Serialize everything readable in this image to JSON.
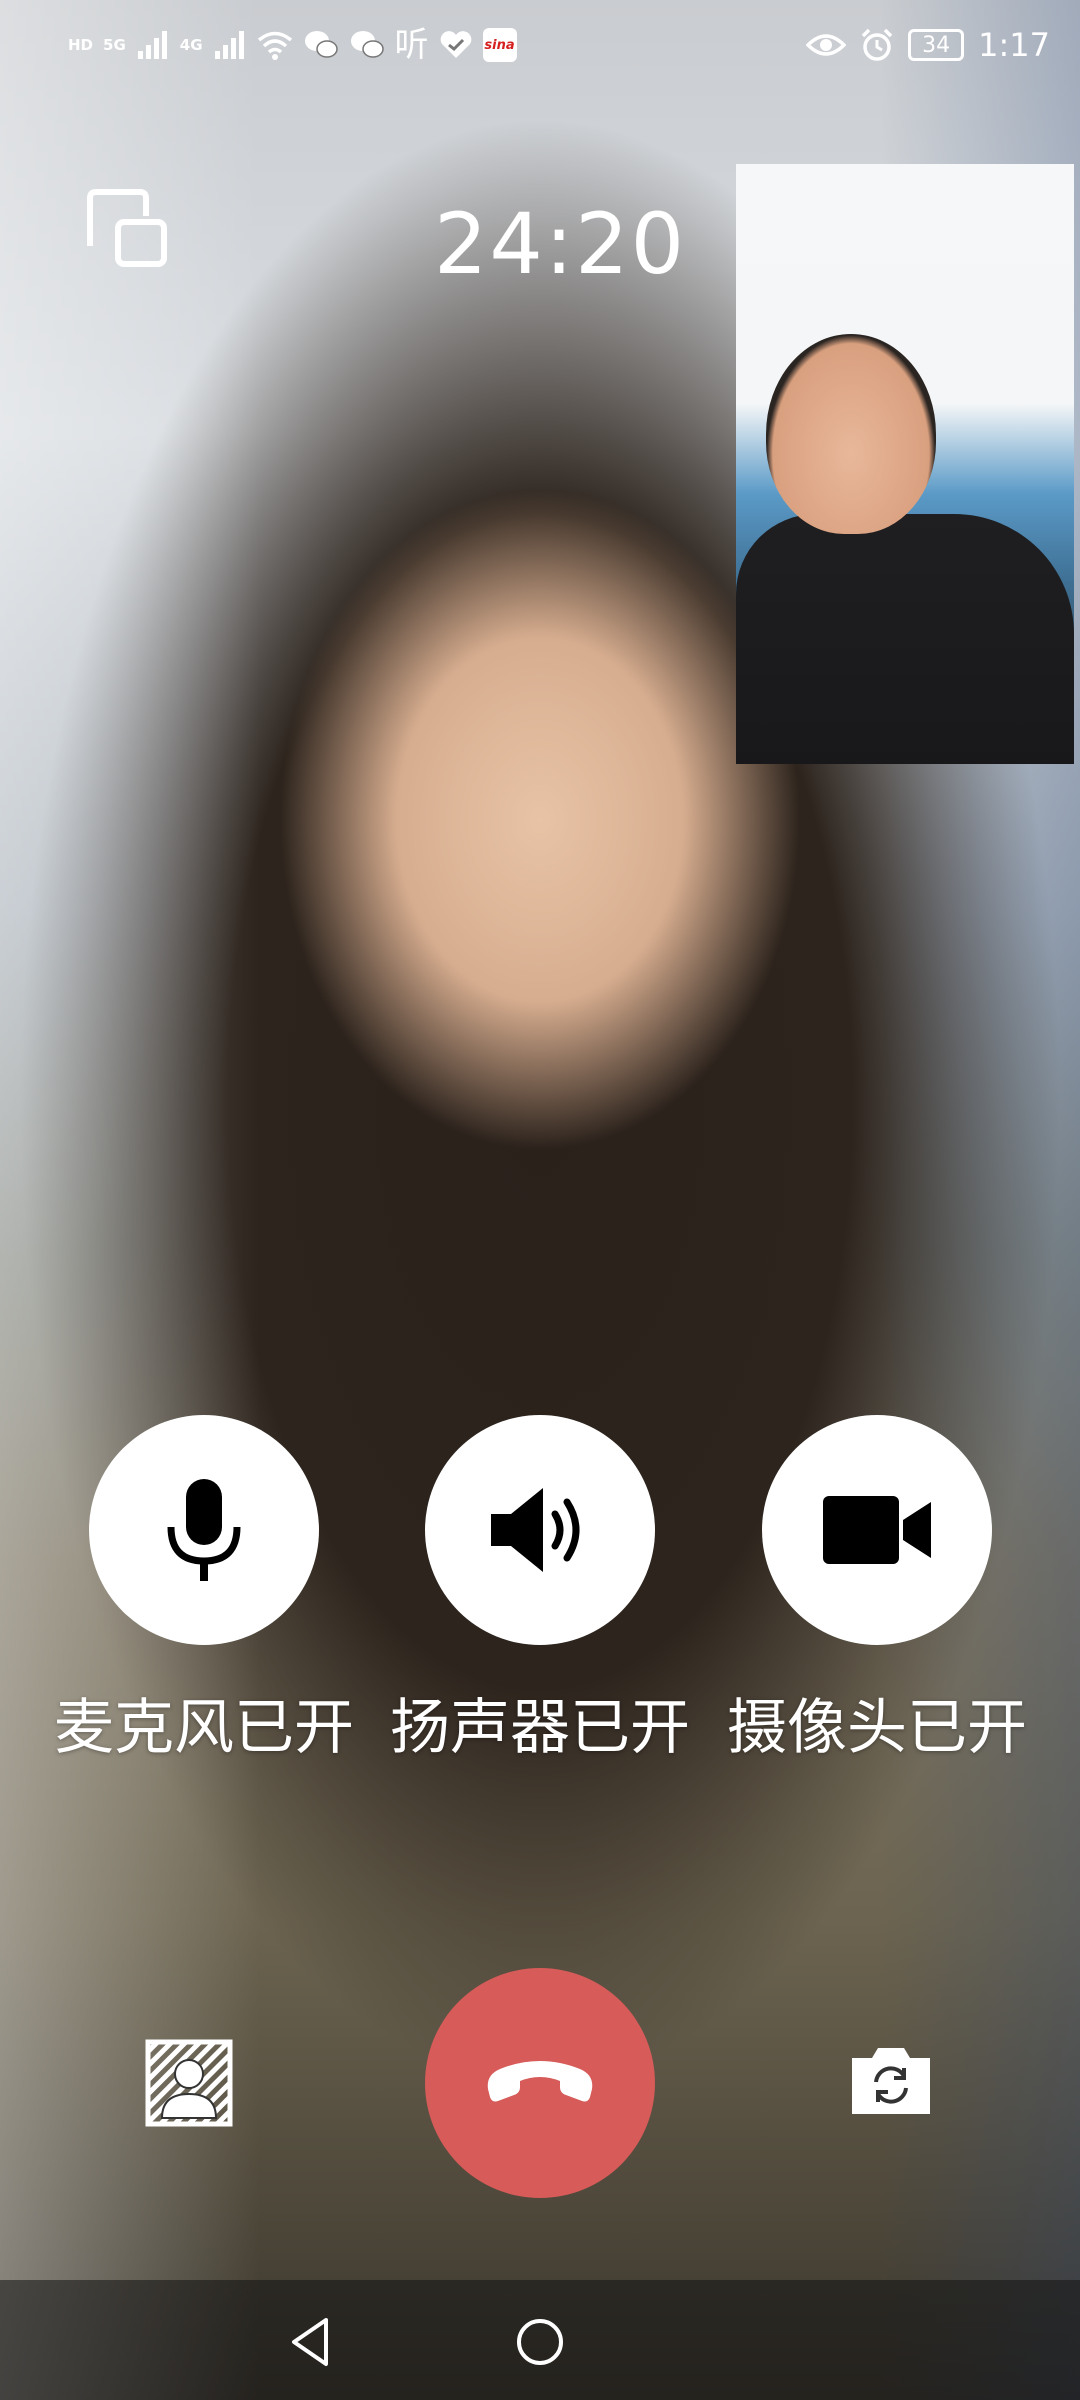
{
  "status_bar": {
    "left_tags": [
      "HD",
      "5G",
      "4G"
    ],
    "listen_icon_text": "听",
    "sina_text": "sina",
    "battery": "34",
    "time": "1:17"
  },
  "call": {
    "duration": "24:20"
  },
  "controls": {
    "microphone": {
      "label": "麦克风已开",
      "icon": "microphone-icon"
    },
    "speaker": {
      "label": "扬声器已开",
      "icon": "speaker-icon"
    },
    "camera": {
      "label": "摄像头已开",
      "icon": "video-camera-icon"
    }
  },
  "bottom_actions": {
    "background_icon": "portrait-background-icon",
    "hangup_icon": "phone-hangup-icon",
    "switch_camera_icon": "camera-switch-icon"
  },
  "colors": {
    "hangup": "#d65b59",
    "control_bg": "#ffffff",
    "text": "#ffffff"
  }
}
